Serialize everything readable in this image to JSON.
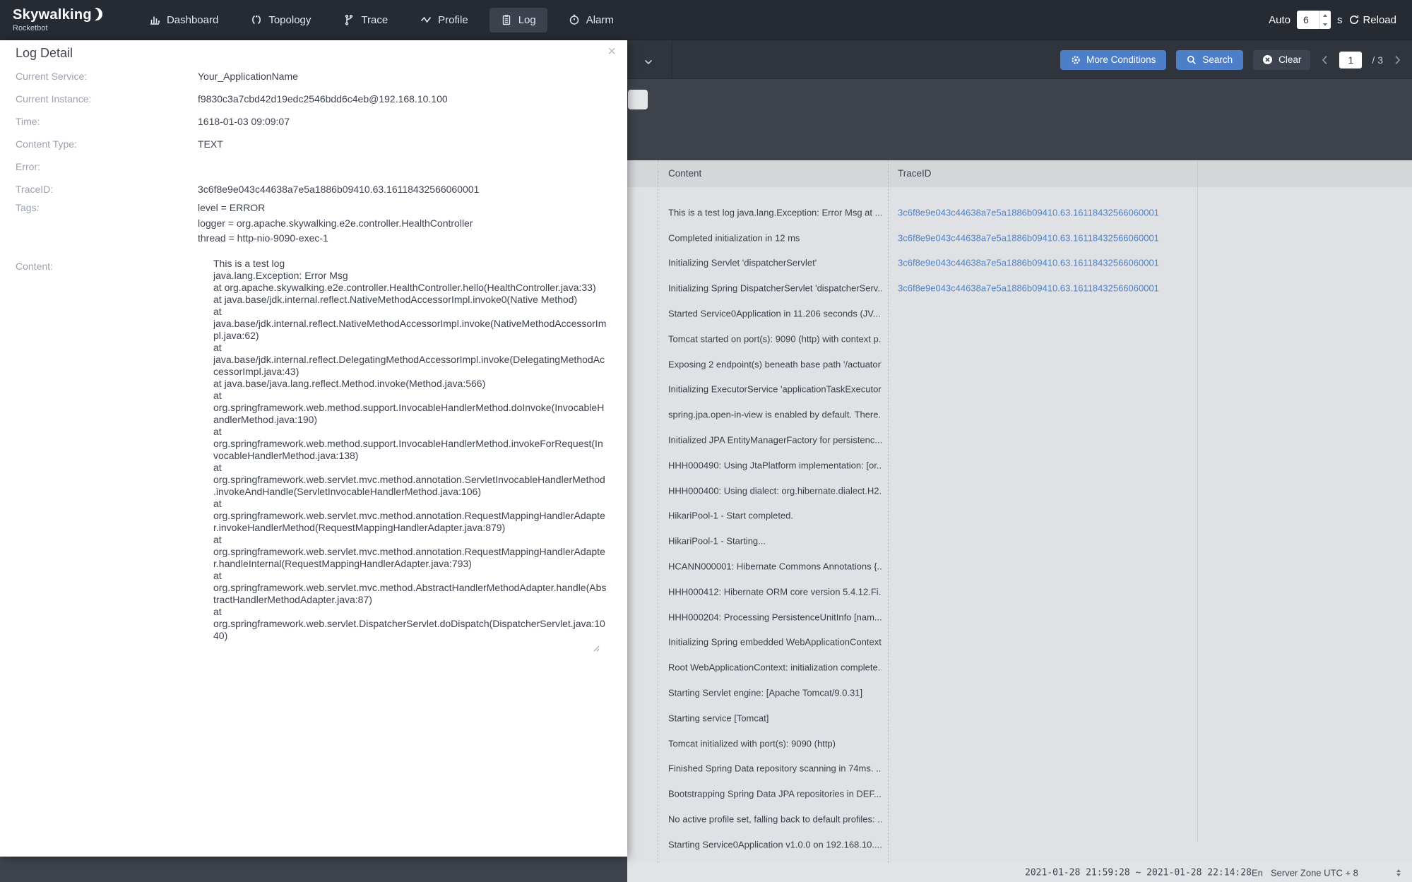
{
  "colors": {
    "nav_bg": "#262b33",
    "band_bg": "#2f343d",
    "filter_bg": "#3e434b",
    "accent_blue": "#4d7fc9",
    "link_blue": "#4e82c8",
    "table_header_bg": "#d4d6da",
    "table_body_bg": "#dfe1e4",
    "footer_bg": "#e1e3e6"
  },
  "nav": {
    "brand": {
      "title": "Skywalking",
      "subtitle": "Rocketbot",
      "logo_icon": "crescent-moon-icon"
    },
    "items": [
      {
        "label": "Dashboard",
        "icon": "dashboard-icon",
        "active": false
      },
      {
        "label": "Topology",
        "icon": "topology-icon",
        "active": false
      },
      {
        "label": "Trace",
        "icon": "trace-icon",
        "active": false
      },
      {
        "label": "Profile",
        "icon": "profile-icon",
        "active": false
      },
      {
        "label": "Log",
        "icon": "log-icon",
        "active": true
      },
      {
        "label": "Alarm",
        "icon": "alarm-icon",
        "active": false
      }
    ],
    "auto": {
      "label": "Auto",
      "value": "6",
      "unit": "s",
      "reload_label": "Reload",
      "reload_icon": "reload-icon"
    }
  },
  "toolbar": {
    "more_conditions_label": "More Conditions",
    "more_conditions_icon": "gear-icon",
    "search_label": "Search",
    "search_icon": "search-icon",
    "clear_label": "Clear",
    "clear_icon": "circle-x-icon",
    "pagination": {
      "current": "1",
      "total_label": "/ 3"
    }
  },
  "modal": {
    "title": "Log Detail",
    "close_glyph": "×",
    "fields": [
      {
        "label": "Current Service:",
        "value": "Your_ApplicationName"
      },
      {
        "label": "Current Instance:",
        "value": "f9830c3a7cbd42d19edc2546bdd6c4eb@192.168.10.100"
      },
      {
        "label": "Time:",
        "value": "1618-01-03 09:09:07"
      },
      {
        "label": "Content Type:",
        "value": "TEXT"
      },
      {
        "label": "Error:",
        "value": ""
      },
      {
        "label": "TraceID:",
        "value": "3c6f8e9e043c44638a7e5a1886b09410.63.16118432566060001"
      }
    ],
    "tags": {
      "label": "Tags:",
      "values": [
        "level = ERROR",
        "logger = org.apache.skywalking.e2e.controller.HealthController",
        "thread = http-nio-9090-exec-1"
      ]
    },
    "content": {
      "label": "Content:",
      "text": "This is a test log\njava.lang.Exception: Error Msg\nat org.apache.skywalking.e2e.controller.HealthController.hello(HealthController.java:33)\nat java.base/jdk.internal.reflect.NativeMethodAccessorImpl.invoke0(Native Method)\nat java.base/jdk.internal.reflect.NativeMethodAccessorImpl.invoke(NativeMethodAccessorImpl.java:62)\nat java.base/jdk.internal.reflect.DelegatingMethodAccessorImpl.invoke(DelegatingMethodAccessorImpl.java:43)\nat java.base/java.lang.reflect.Method.invoke(Method.java:566)\nat org.springframework.web.method.support.InvocableHandlerMethod.doInvoke(InvocableHandlerMethod.java:190)\nat org.springframework.web.method.support.InvocableHandlerMethod.invokeForRequest(InvocableHandlerMethod.java:138)\nat org.springframework.web.servlet.mvc.method.annotation.ServletInvocableHandlerMethod.invokeAndHandle(ServletInvocableHandlerMethod.java:106)\nat org.springframework.web.servlet.mvc.method.annotation.RequestMappingHandlerAdapter.invokeHandlerMethod(RequestMappingHandlerAdapter.java:879)\nat org.springframework.web.servlet.mvc.method.annotation.RequestMappingHandlerAdapter.handleInternal(RequestMappingHandlerAdapter.java:793)\nat org.springframework.web.servlet.mvc.method.AbstractHandlerMethodAdapter.handle(AbstractHandlerMethodAdapter.java:87)\nat org.springframework.web.servlet.DispatcherServlet.doDispatch(DispatcherServlet.java:1040)"
    }
  },
  "table": {
    "columns": [
      "Content",
      "TraceID"
    ],
    "rows": [
      {
        "content": "This is a test log java.lang.Exception: Error Msg at ...",
        "traceId": "3c6f8e9e043c44638a7e5a1886b09410.63.16118432566060001"
      },
      {
        "content": "Completed initialization in 12 ms",
        "traceId": "3c6f8e9e043c44638a7e5a1886b09410.63.16118432566060001"
      },
      {
        "content": "Initializing Servlet 'dispatcherServlet'",
        "traceId": "3c6f8e9e043c44638a7e5a1886b09410.63.16118432566060001"
      },
      {
        "content": "Initializing Spring DispatcherServlet 'dispatcherServ...",
        "traceId": "3c6f8e9e043c44638a7e5a1886b09410.63.16118432566060001"
      },
      {
        "content": "Started Service0Application in 11.206 seconds (JV...",
        "traceId": ""
      },
      {
        "content": "Tomcat started on port(s): 9090 (http) with context p...",
        "traceId": ""
      },
      {
        "content": "Exposing 2 endpoint(s) beneath base path '/actuator'",
        "traceId": ""
      },
      {
        "content": "Initializing ExecutorService 'applicationTaskExecutor'",
        "traceId": ""
      },
      {
        "content": "spring.jpa.open-in-view is enabled by default. There...",
        "traceId": ""
      },
      {
        "content": "Initialized JPA EntityManagerFactory for persistenc...",
        "traceId": ""
      },
      {
        "content": "HHH000490: Using JtaPlatform implementation: [or...",
        "traceId": ""
      },
      {
        "content": "HHH000400: Using dialect: org.hibernate.dialect.H2...",
        "traceId": ""
      },
      {
        "content": "HikariPool-1 - Start completed.",
        "traceId": ""
      },
      {
        "content": "HikariPool-1 - Starting...",
        "traceId": ""
      },
      {
        "content": "HCANN000001: Hibernate Commons Annotations {...",
        "traceId": ""
      },
      {
        "content": "HHH000412: Hibernate ORM core version 5.4.12.Fi...",
        "traceId": ""
      },
      {
        "content": "HHH000204: Processing PersistenceUnitInfo [nam...",
        "traceId": ""
      },
      {
        "content": "Initializing Spring embedded WebApplicationContext",
        "traceId": ""
      },
      {
        "content": "Root WebApplicationContext: initialization complete...",
        "traceId": ""
      },
      {
        "content": "Starting Servlet engine: [Apache Tomcat/9.0.31]",
        "traceId": ""
      },
      {
        "content": "Starting service [Tomcat]",
        "traceId": ""
      },
      {
        "content": "Tomcat initialized with port(s): 9090 (http)",
        "traceId": ""
      },
      {
        "content": "Finished Spring Data repository scanning in 74ms. ...",
        "traceId": ""
      },
      {
        "content": "Bootstrapping Spring Data JPA repositories in DEF...",
        "traceId": ""
      },
      {
        "content": "No active profile set, falling back to default profiles: ...",
        "traceId": ""
      },
      {
        "content": "Starting Service0Application v1.0.0 on 192.168.10....",
        "traceId": ""
      }
    ]
  },
  "footer": {
    "time_range": "2021-01-28 21:59:28 ~ 2021-01-28 22:14:28",
    "language": "En",
    "server_zone": "Server Zone UTC + 8"
  }
}
